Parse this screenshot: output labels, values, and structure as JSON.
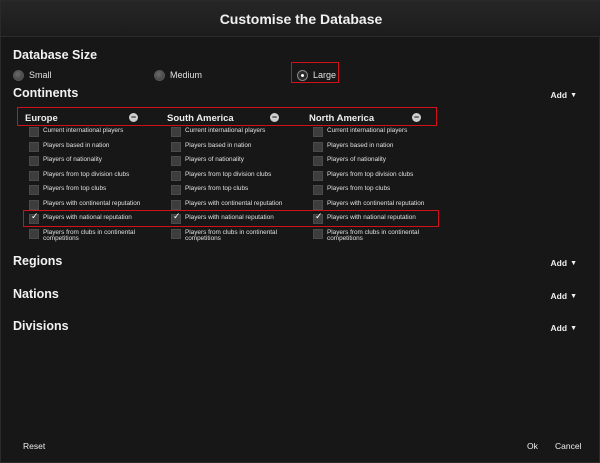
{
  "window": {
    "title": "Customise the Database"
  },
  "database_size": {
    "title": "Database Size",
    "options": [
      {
        "label": "Small",
        "selected": false
      },
      {
        "label": "Medium",
        "selected": false
      },
      {
        "label": "Large",
        "selected": true
      }
    ]
  },
  "continents": {
    "title": "Continents",
    "add_label": "Add",
    "columns": [
      {
        "name": "Europe",
        "options": [
          {
            "label": "Current international players",
            "checked": false
          },
          {
            "label": "Players based in nation",
            "checked": false
          },
          {
            "label": "Players of nationality",
            "checked": false
          },
          {
            "label": "Players from top division clubs",
            "checked": false
          },
          {
            "label": "Players from top clubs",
            "checked": false
          },
          {
            "label": "Players with continental reputation",
            "checked": false
          },
          {
            "label": "Players with national reputation",
            "checked": true
          },
          {
            "label": "Players from clubs in continental competitions",
            "checked": false
          }
        ]
      },
      {
        "name": "South America",
        "options": [
          {
            "label": "Current international players",
            "checked": false
          },
          {
            "label": "Players based in nation",
            "checked": false
          },
          {
            "label": "Players of nationality",
            "checked": false
          },
          {
            "label": "Players from top division clubs",
            "checked": false
          },
          {
            "label": "Players from top clubs",
            "checked": false
          },
          {
            "label": "Players with continental reputation",
            "checked": false
          },
          {
            "label": "Players with national reputation",
            "checked": true
          },
          {
            "label": "Players from clubs in continental competitions",
            "checked": false
          }
        ]
      },
      {
        "name": "North America",
        "options": [
          {
            "label": "Current international players",
            "checked": false
          },
          {
            "label": "Players based in nation",
            "checked": false
          },
          {
            "label": "Players of nationality",
            "checked": false
          },
          {
            "label": "Players from top division clubs",
            "checked": false
          },
          {
            "label": "Players from top clubs",
            "checked": false
          },
          {
            "label": "Players with continental reputation",
            "checked": false
          },
          {
            "label": "Players with national reputation",
            "checked": true
          },
          {
            "label": "Players from clubs in continental competitions",
            "checked": false
          }
        ]
      }
    ]
  },
  "regions": {
    "title": "Regions",
    "add_label": "Add"
  },
  "nations": {
    "title": "Nations",
    "add_label": "Add"
  },
  "divisions": {
    "title": "Divisions",
    "add_label": "Add"
  },
  "footer": {
    "reset_label": "Reset",
    "ok_label": "Ok",
    "cancel_label": "Cancel"
  },
  "colors": {
    "highlight": "#d0101a",
    "background": "#171717"
  },
  "icons": {
    "collapse": "minus-circle-icon",
    "add_caret": "caret-down-icon",
    "checkbox_check": "checkmark-icon"
  }
}
